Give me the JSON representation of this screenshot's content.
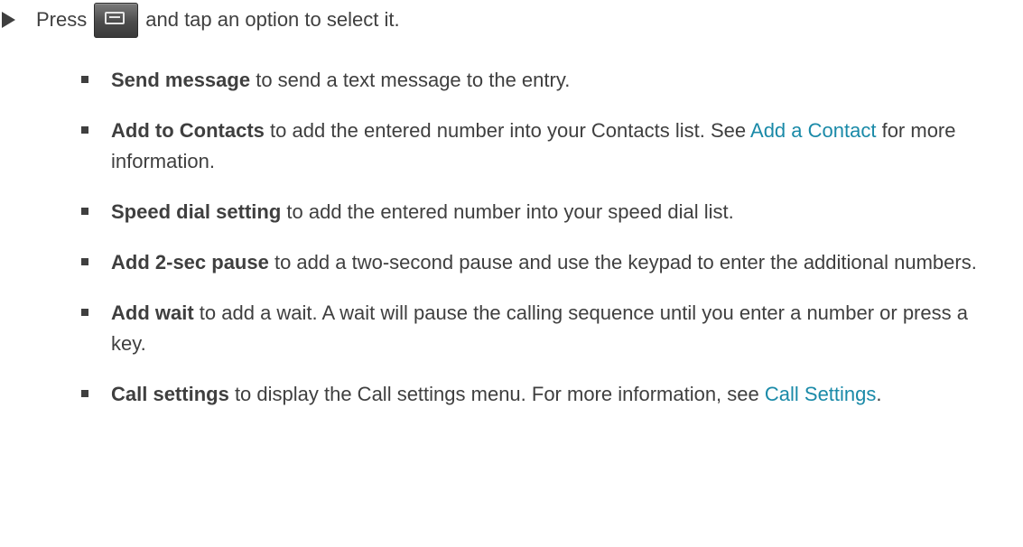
{
  "step": {
    "before_icon": "Press",
    "after_icon": "and tap an option to select it.",
    "arrow_icon": "right-triangle-bullet",
    "key_icon": "menu-key-icon"
  },
  "colors": {
    "text": "#3f3f3f",
    "link": "#1a8aa8"
  },
  "options": [
    {
      "term": "Send message",
      "text": "to send a text message to the entry."
    },
    {
      "term": "Add to Contacts",
      "text": "to add the entered number into your Contacts list. See",
      "link": "Add a Contact",
      "after": "for more information."
    },
    {
      "term": "Speed dial setting",
      "text": "to add the entered number into your speed dial list."
    },
    {
      "term": "Add 2-sec pause",
      "text": "to add a two-second pause and use the keypad to enter the additional numbers."
    },
    {
      "term": "Add wait",
      "text": "to add a wait. A wait will pause the calling sequence until you enter a number or press a key."
    },
    {
      "term": "Call settings",
      "text": "to display the Call settings menu. For more information, see",
      "link": "Call Settings",
      "after": "."
    }
  ]
}
